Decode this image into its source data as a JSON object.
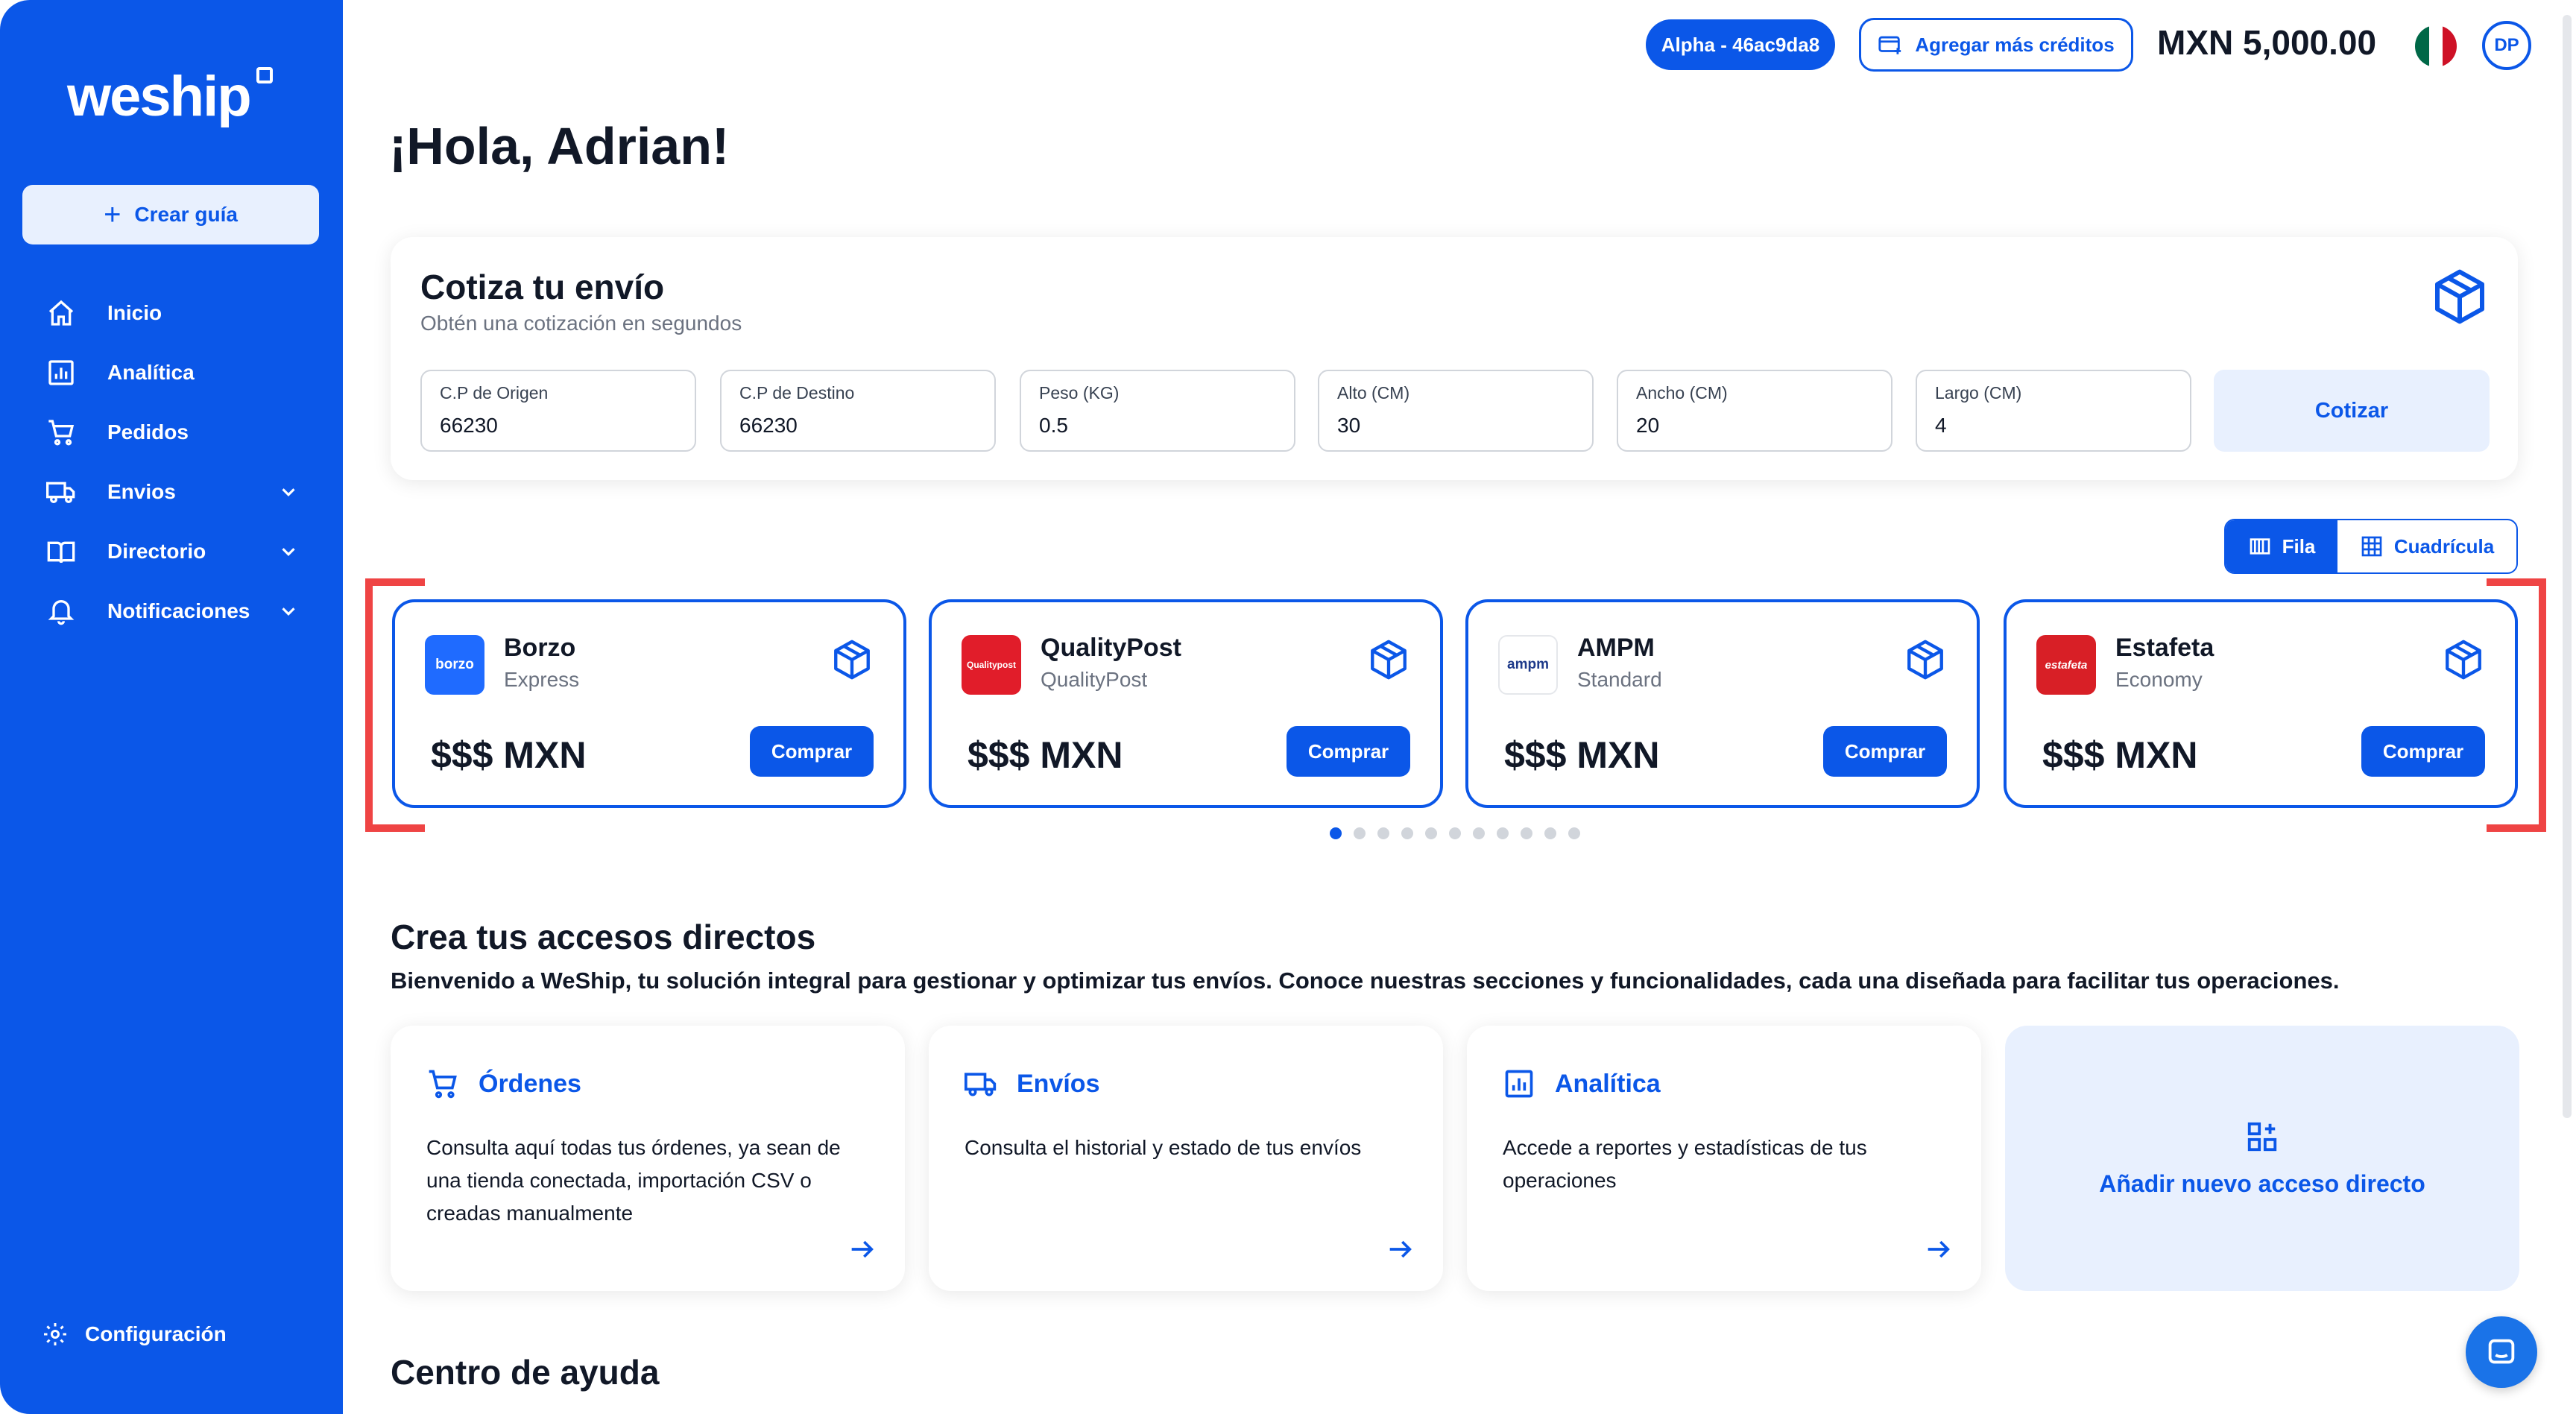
{
  "app": {
    "brand": "weship"
  },
  "sidebar": {
    "create_label": "Crear guía",
    "items": [
      {
        "label": "Inicio",
        "icon": "home-icon"
      },
      {
        "label": "Analítica",
        "icon": "chart-icon"
      },
      {
        "label": "Pedidos",
        "icon": "cart-icon"
      },
      {
        "label": "Envios",
        "icon": "truck-icon"
      },
      {
        "label": "Directorio",
        "icon": "book-icon"
      },
      {
        "label": "Notificaciones",
        "icon": "bell-icon"
      }
    ],
    "config_label": "Configuración"
  },
  "header": {
    "env_badge": "Alpha - 46ac9da8",
    "add_credits_label": "Agregar más créditos",
    "balance": "MXN 5,000.00",
    "avatar_initials": "DP"
  },
  "greeting": "¡Hola, Adrian!",
  "quote": {
    "title": "Cotiza tu envío",
    "subtitle": "Obtén una cotización en segundos",
    "fields": [
      {
        "label": "C.P de Origen",
        "value": "66230"
      },
      {
        "label": "C.P de Destino",
        "value": "66230"
      },
      {
        "label": "Peso (KG)",
        "value": "0.5"
      },
      {
        "label": "Alto (CM)",
        "value": "30"
      },
      {
        "label": "Ancho (CM)",
        "value": "20"
      },
      {
        "label": "Largo (CM)",
        "value": "4"
      }
    ],
    "submit_label": "Cotizar"
  },
  "view_toggle": {
    "row_label": "Fila",
    "grid_label": "Cuadrícula"
  },
  "carriers": [
    {
      "name": "Borzo",
      "service": "Express",
      "logo_text": "borzo",
      "logo_color": "#1f6bff",
      "price": "$$$ MXN",
      "buy_label": "Comprar"
    },
    {
      "name": "QualityPost",
      "service": "QualityPost",
      "logo_text": "Qualitypost",
      "logo_color": "#e11d2a",
      "price": "$$$ MXN",
      "buy_label": "Comprar"
    },
    {
      "name": "AMPM",
      "service": "Standard",
      "logo_text": "ampm",
      "logo_color": "#ffffff",
      "price": "$$$ MXN",
      "buy_label": "Comprar"
    },
    {
      "name": "Estafeta",
      "service": "Economy",
      "logo_text": "estafeta",
      "logo_color": "#d81f26",
      "price": "$$$ MXN",
      "buy_label": "Comprar"
    }
  ],
  "shortcuts": {
    "title": "Crea tus accesos directos",
    "description": "Bienvenido a WeShip, tu solución integral para gestionar y optimizar tus envíos. Conoce nuestras secciones y funcionalidades, cada una diseñada para facilitar tus operaciones.",
    "items": [
      {
        "title": "Órdenes",
        "desc": "Consulta aquí todas tus órdenes, ya sean de una tienda conectada, importación CSV o creadas manualmente"
      },
      {
        "title": "Envíos",
        "desc": "Consulta el historial y estado de tus envíos"
      },
      {
        "title": "Analítica",
        "desc": "Accede a reportes y estadísticas de tus operaciones"
      }
    ],
    "add_label": "Añadir nuevo acceso directo"
  },
  "help": {
    "title": "Centro de ayuda"
  },
  "colors": {
    "primary": "#0b57e8",
    "highlight": "#ef4444",
    "soft": "#e8f0fe"
  }
}
